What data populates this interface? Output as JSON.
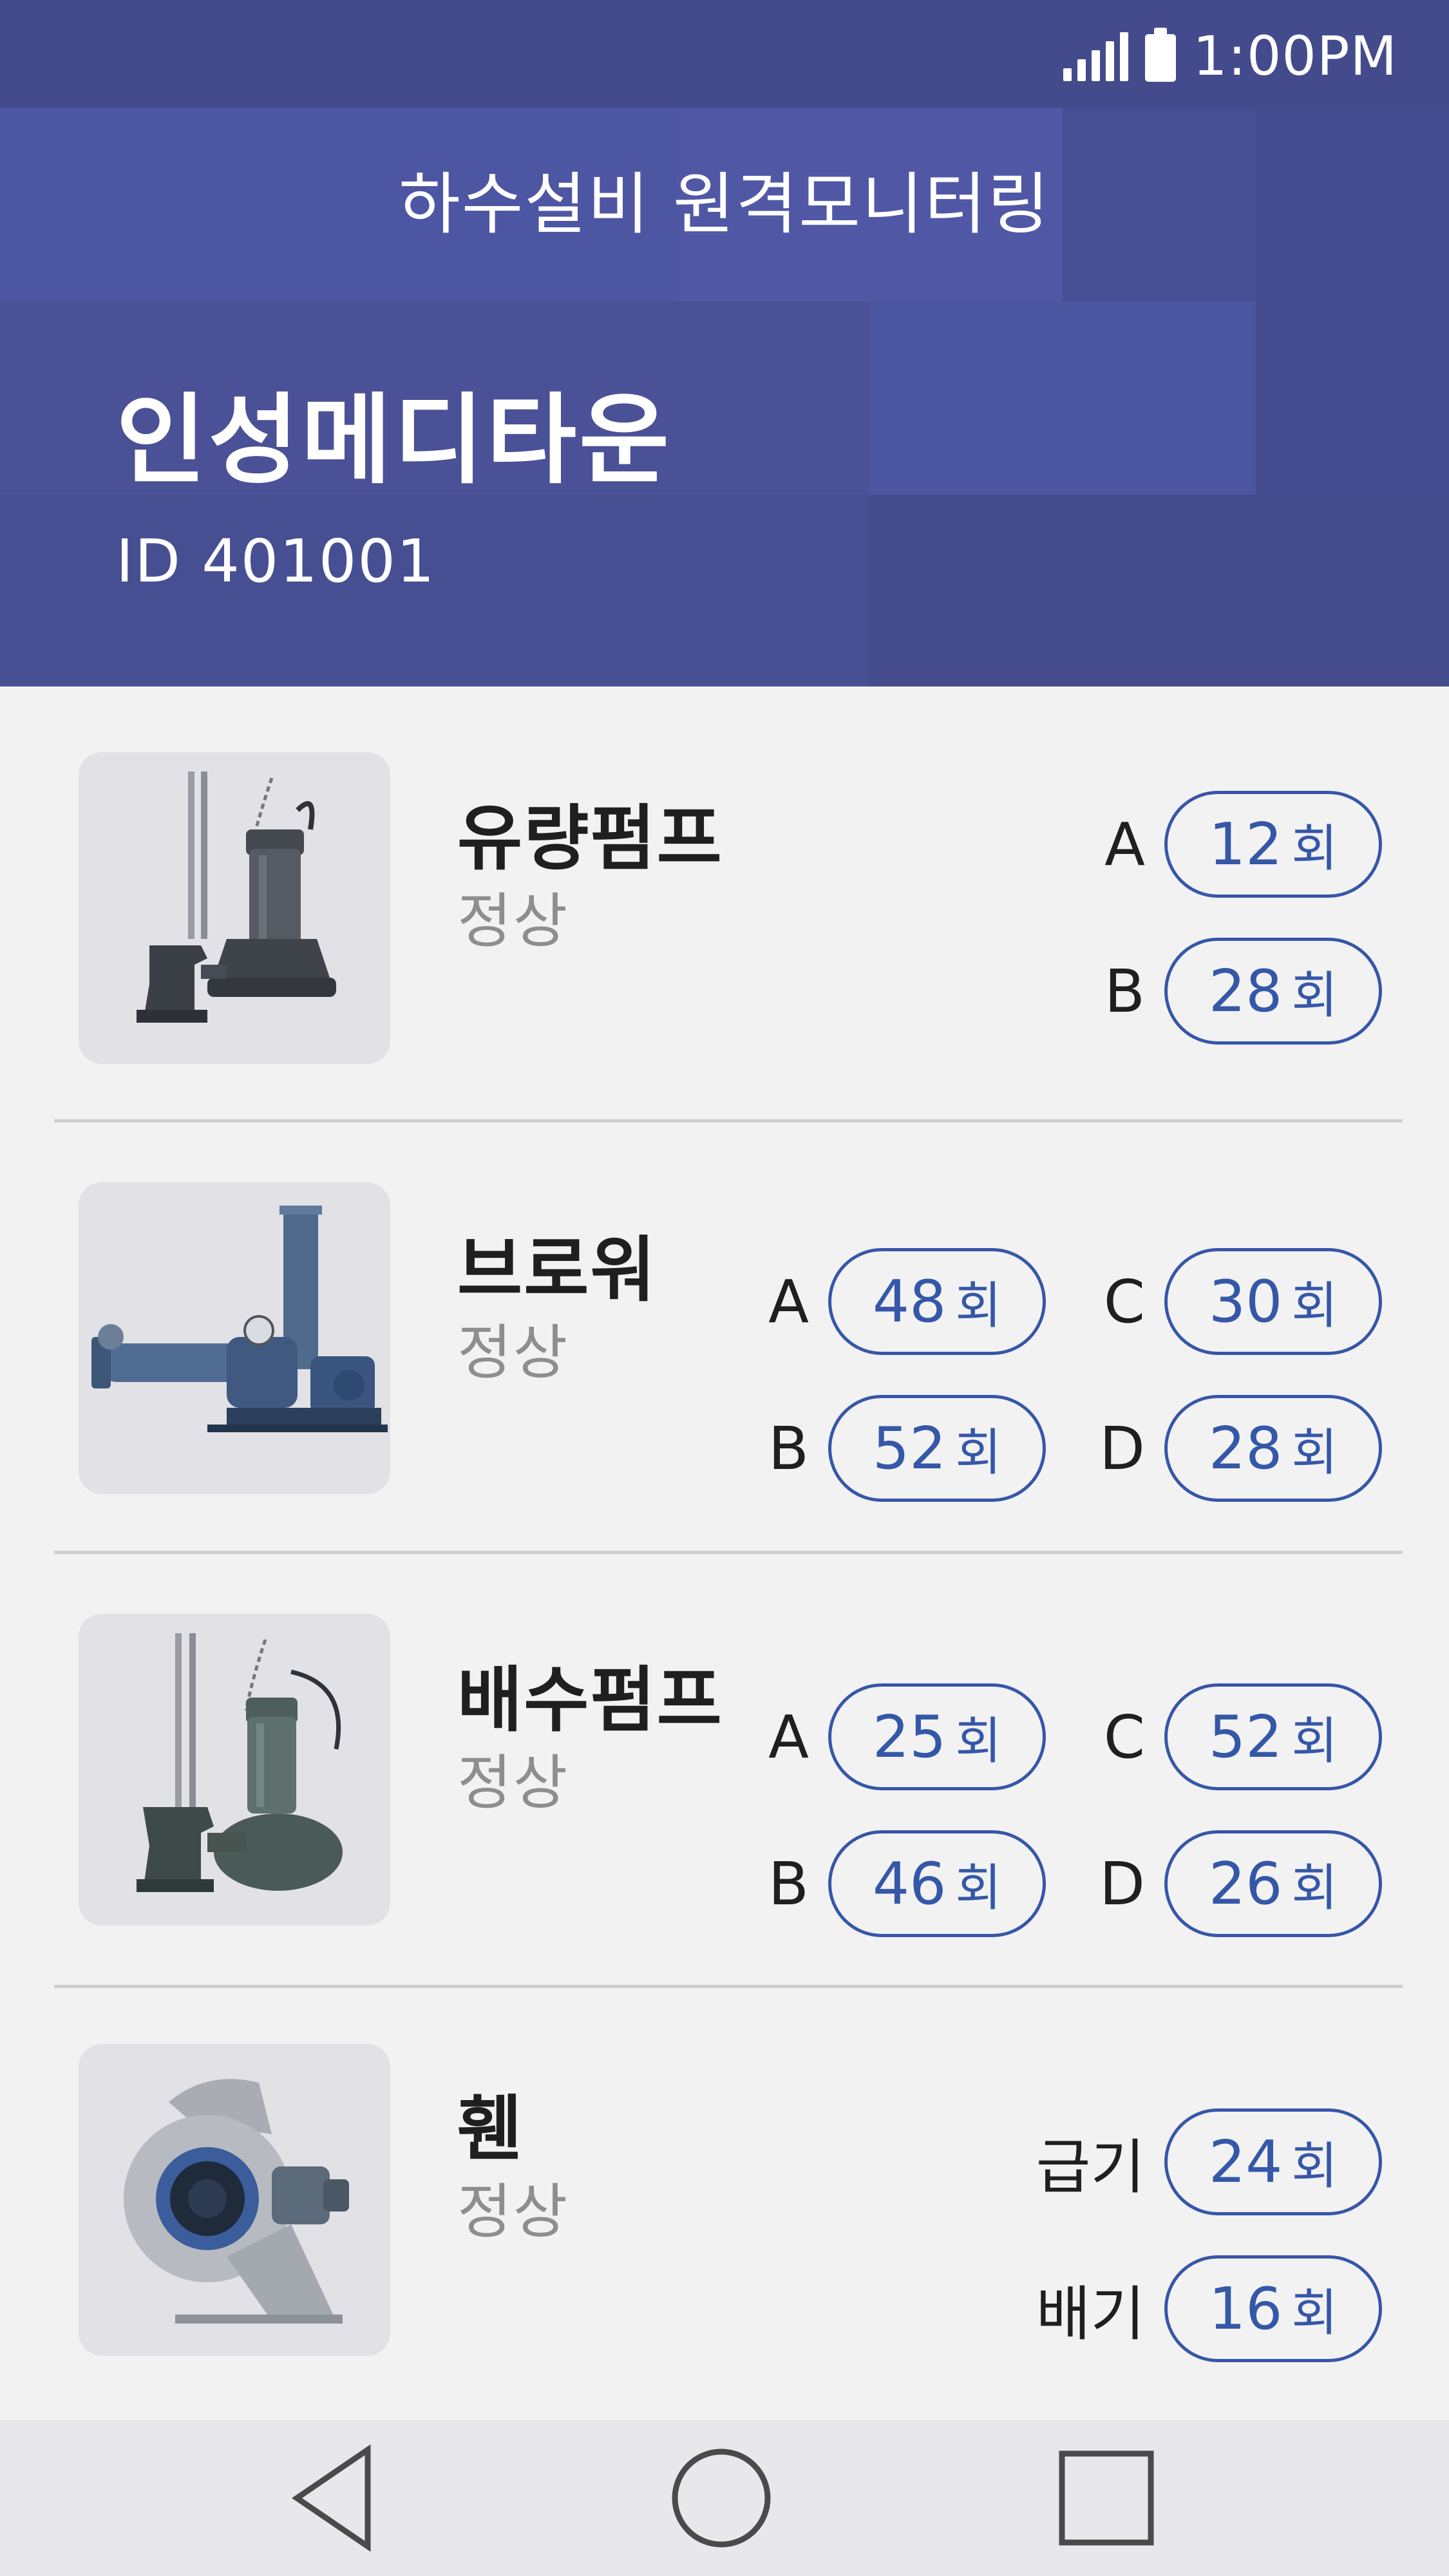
{
  "status_bar": {
    "time": "1:00PM",
    "signal_icon": "signal-icon",
    "battery_icon": "battery-icon"
  },
  "header": {
    "app_title": "하수설비 원격모니터링",
    "site_name": "인성메디타운",
    "site_id": "ID  401001",
    "colors": {
      "base": "#4a5196",
      "status_bar": "#434b8c"
    }
  },
  "equipment": [
    {
      "name": "유량펌프",
      "status": "정상",
      "image_icon": "submersible-pump-icon",
      "counters": [
        {
          "label": "A",
          "value": "12",
          "unit": "회"
        },
        {
          "label": "B",
          "value": "28",
          "unit": "회"
        }
      ]
    },
    {
      "name": "브로워",
      "status": "정상",
      "image_icon": "blower-icon",
      "counters": [
        {
          "label": "A",
          "value": "48",
          "unit": "회"
        },
        {
          "label": "B",
          "value": "52",
          "unit": "회"
        },
        {
          "label": "C",
          "value": "30",
          "unit": "회"
        },
        {
          "label": "D",
          "value": "28",
          "unit": "회"
        }
      ]
    },
    {
      "name": "배수펌프",
      "status": "정상",
      "image_icon": "drainage-pump-icon",
      "counters": [
        {
          "label": "A",
          "value": "25",
          "unit": "회"
        },
        {
          "label": "B",
          "value": "46",
          "unit": "회"
        },
        {
          "label": "C",
          "value": "52",
          "unit": "회"
        },
        {
          "label": "D",
          "value": "26",
          "unit": "회"
        }
      ]
    },
    {
      "name": "휀",
      "status": "정상",
      "image_icon": "fan-icon",
      "counters": [
        {
          "label": "급기",
          "value": "24",
          "unit": "회"
        },
        {
          "label": "배기",
          "value": "16",
          "unit": "회"
        }
      ]
    }
  ],
  "nav": {
    "back_icon": "back-triangle-icon",
    "home_icon": "home-circle-icon",
    "recents_icon": "recents-square-icon"
  },
  "colors": {
    "accent": "#3557a8",
    "text": "#1f1f1f",
    "status_text": "#8e8e8e",
    "background": "#f2f2f3",
    "thumb_bg": "#e1e1e6"
  }
}
